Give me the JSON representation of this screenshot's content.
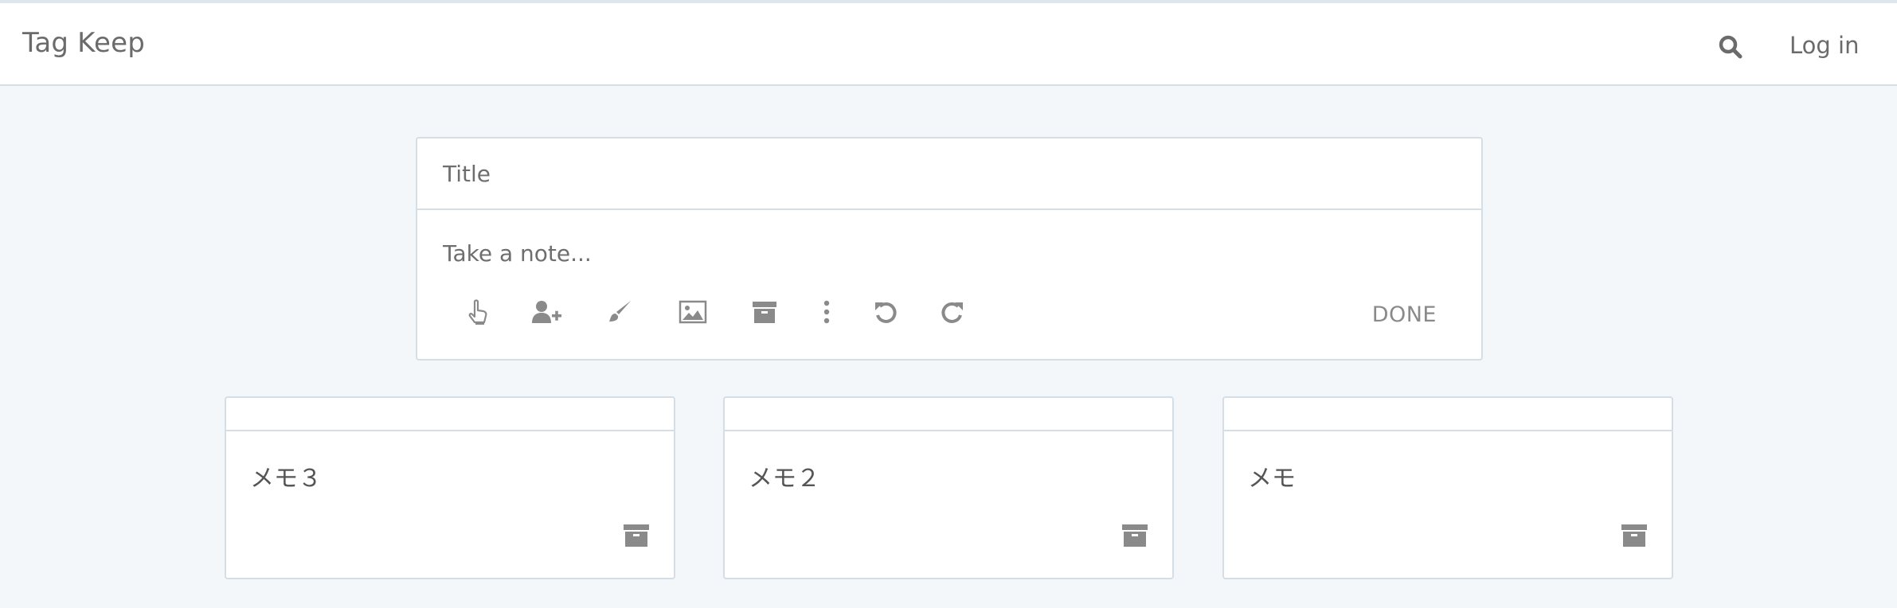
{
  "header": {
    "brand": "Tag Keep",
    "search_icon": "search-icon",
    "login_label": "Log in"
  },
  "editor": {
    "title_placeholder": "Title",
    "title_value": "",
    "note_placeholder": "Take a note...",
    "note_value": "",
    "toolbar": [
      {
        "name": "pin-icon"
      },
      {
        "name": "add-collaborator-icon"
      },
      {
        "name": "color-brush-icon"
      },
      {
        "name": "image-icon"
      },
      {
        "name": "archive-icon"
      },
      {
        "name": "more-icon"
      },
      {
        "name": "undo-icon"
      },
      {
        "name": "redo-icon"
      }
    ],
    "done_label": "DONE"
  },
  "notes": [
    {
      "title": "",
      "body": "メモ３"
    },
    {
      "title": "",
      "body": "メモ２"
    },
    {
      "title": "",
      "body": "メモ"
    }
  ],
  "colors": {
    "page_bg": "#f3f7fa",
    "border": "#d4dee6",
    "icon": "#8a8a8a",
    "text": "#555555"
  }
}
